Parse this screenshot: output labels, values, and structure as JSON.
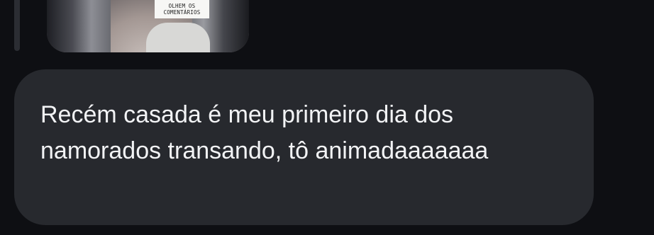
{
  "thread": {
    "media_caption_line1": "OLHEM OS",
    "media_caption_line2": "COMENTÁRIOS"
  },
  "message": {
    "text": "Recém casada é meu primeiro dia dos namorados transando, tô animadaaaaaaa"
  }
}
